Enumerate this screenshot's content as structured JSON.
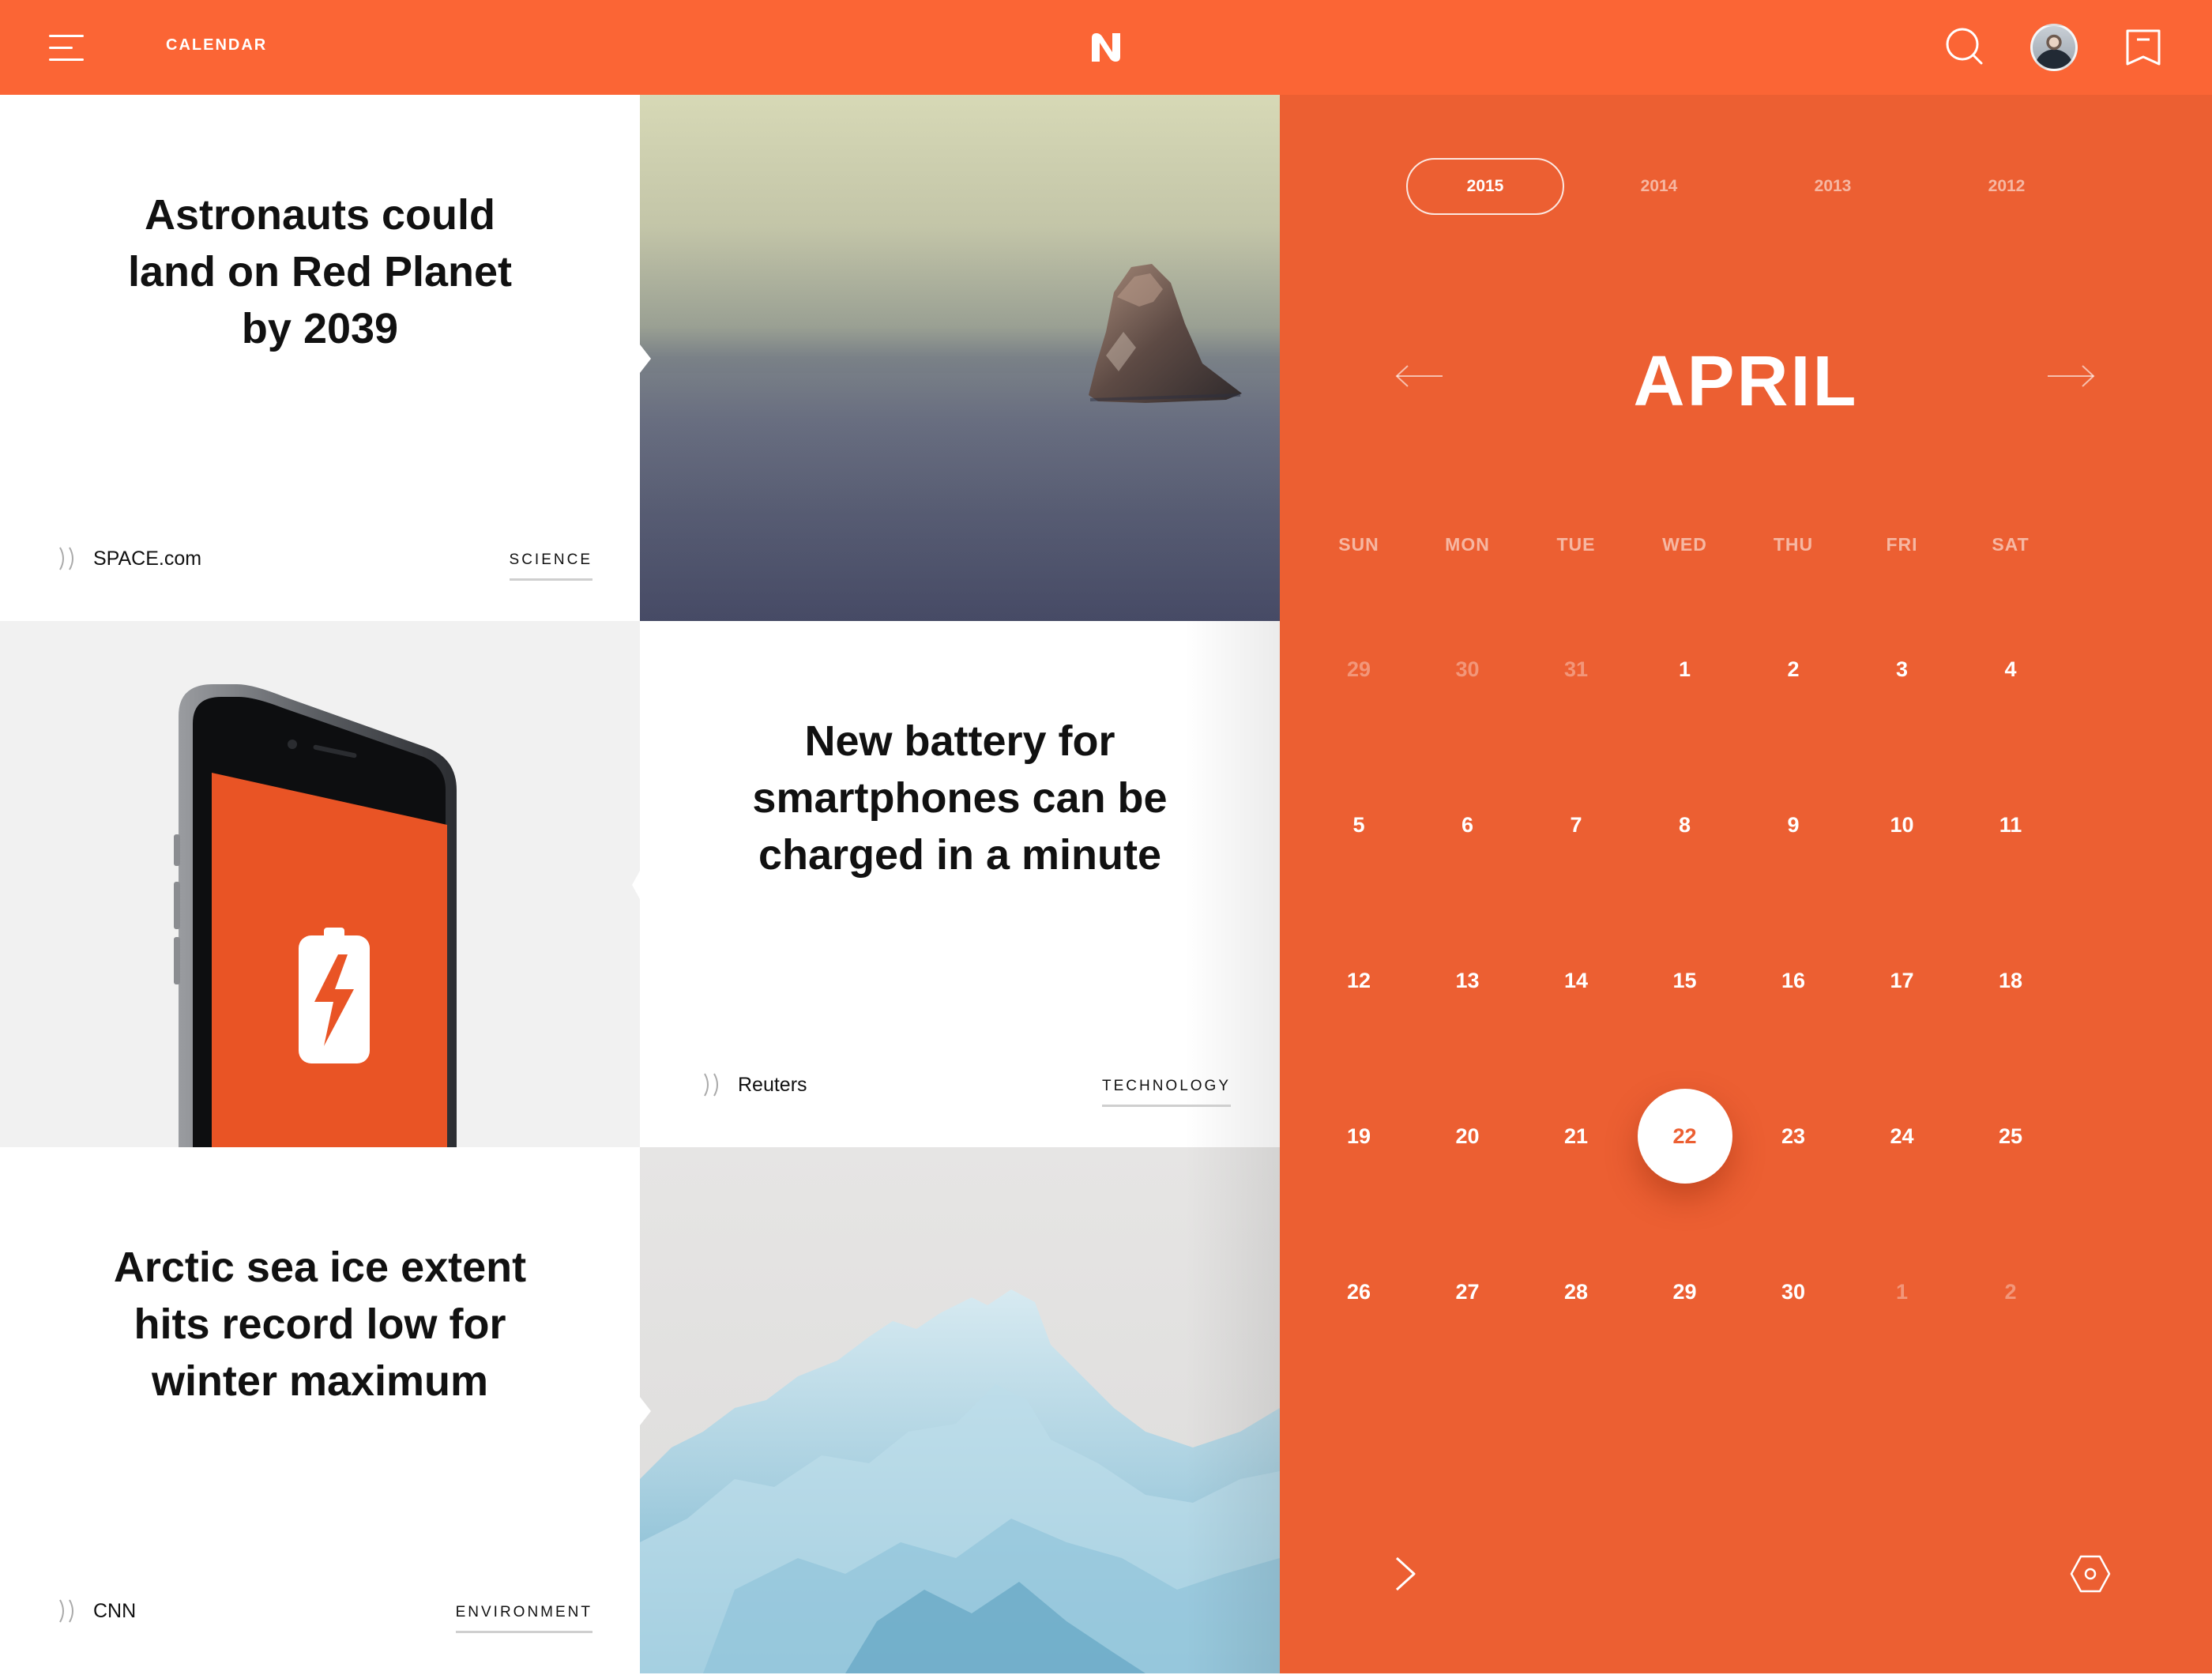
{
  "header": {
    "title": "CALENDAR",
    "logo_letter": "N",
    "accent": "#fb6535"
  },
  "articles": [
    {
      "headline": "Astronauts could land on Red Planet by 2039",
      "source": "SPACE.com",
      "category": "SCIENCE",
      "image": "sea-rock-photo"
    },
    {
      "headline": "New battery for smartphones can be charged in a minute",
      "source": "Reuters",
      "category": "TECHNOLOGY",
      "image": "smartphone-battery-photo"
    },
    {
      "headline": "Arctic sea ice extent hits record low for winter maximum",
      "source": "CNN",
      "category": "ENVIRONMENT",
      "image": "arctic-ice-photo"
    }
  ],
  "calendar": {
    "background": "#ec5f32",
    "years": [
      "2015",
      "2014",
      "2013",
      "2012"
    ],
    "active_year": "2015",
    "month": "APRIL",
    "weekdays": [
      "SUN",
      "MON",
      "TUE",
      "WED",
      "THU",
      "FRI",
      "SAT"
    ],
    "weeks": [
      [
        "29",
        "30",
        "31",
        "1",
        "2",
        "3",
        "4"
      ],
      [
        "5",
        "6",
        "7",
        "8",
        "9",
        "10",
        "11"
      ],
      [
        "12",
        "13",
        "14",
        "15",
        "16",
        "17",
        "18"
      ],
      [
        "19",
        "20",
        "21",
        "22",
        "23",
        "24",
        "25"
      ],
      [
        "26",
        "27",
        "28",
        "29",
        "30",
        "1",
        "2"
      ]
    ],
    "selected_day": "22"
  }
}
